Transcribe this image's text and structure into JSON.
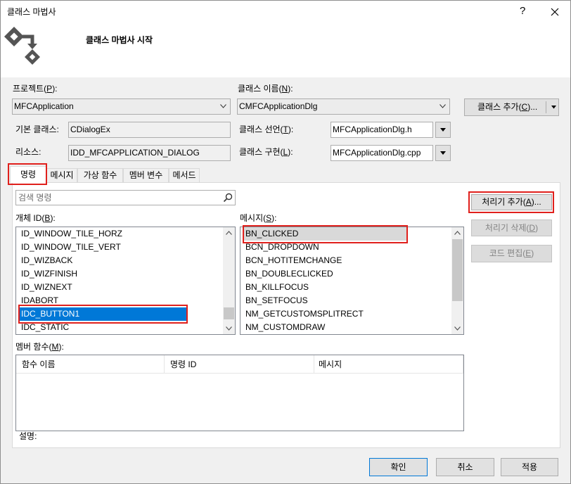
{
  "window": {
    "title": "클래스 마법사",
    "help": "?"
  },
  "header": {
    "title": "클래스 마법사 시작"
  },
  "icons": {
    "header": "class-wizard-icon",
    "close": "close-icon",
    "search": "search-icon",
    "dropdown": "chevron-down-icon"
  },
  "project": {
    "label": "프로젝트(P):",
    "value": "MFCApplication"
  },
  "class_name": {
    "label": "클래스 이름(N):",
    "value": "CMFCApplicationDlg"
  },
  "add_class_button": {
    "label": "클래스 추가(C)..."
  },
  "base_class": {
    "label": "기본 클래스:",
    "value": "CDialogEx"
  },
  "class_declaration": {
    "label": "클래스 선언(T):",
    "value": "MFCApplicationDlg.h"
  },
  "resource": {
    "label": "리소스:",
    "value": "IDD_MFCAPPLICATION_DIALOG"
  },
  "class_implementation": {
    "label": "클래스 구현(L):",
    "value": "MFCApplicationDlg.cpp"
  },
  "tabs": [
    {
      "label": "명령",
      "selected": true
    },
    {
      "label": "메시지",
      "selected": false
    },
    {
      "label": "가상 함수",
      "selected": false
    },
    {
      "label": "멤버 변수",
      "selected": false
    },
    {
      "label": "메서드",
      "selected": false
    }
  ],
  "search": {
    "placeholder": "검색 명령"
  },
  "object_ids": {
    "label": "개체 ID(B):",
    "items": [
      "ID_WINDOW_TILE_HORZ",
      "ID_WINDOW_TILE_VERT",
      "ID_WIZBACK",
      "ID_WIZFINISH",
      "ID_WIZNEXT",
      "IDABORT",
      "IDC_BUTTON1",
      "IDC_STATIC"
    ],
    "selected_index": 6
  },
  "messages": {
    "label": "메시지(S):",
    "items": [
      "BN_CLICKED",
      "BCN_DROPDOWN",
      "BCN_HOTITEMCHANGE",
      "BN_DOUBLECLICKED",
      "BN_KILLFOCUS",
      "BN_SETFOCUS",
      "NM_GETCUSTOMSPLITRECT",
      "NM_CUSTOMDRAW"
    ],
    "selected_index": 0
  },
  "handler_buttons": {
    "add": "처리기 추가(A)...",
    "delete": "처리기 삭제(D)",
    "edit_code": "코드 편집(E)"
  },
  "member_functions": {
    "label": "멤버 함수(M):",
    "columns": [
      "함수 이름",
      "명령 ID",
      "메시지"
    ],
    "rows": []
  },
  "description": {
    "label": "설명:"
  },
  "footer": {
    "ok": "확인",
    "cancel": "취소",
    "apply": "적용"
  },
  "colors": {
    "selection": "#0078d7",
    "annotation": "#e0201c",
    "default_button_border": "#0078d7"
  }
}
